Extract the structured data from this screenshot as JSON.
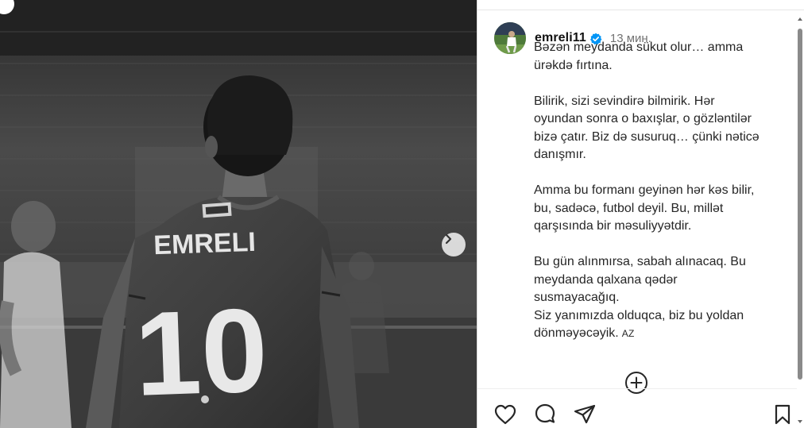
{
  "photo": {
    "jersey_name": "EMRELI",
    "jersey_number": "10",
    "alt_icon": "carousel-next-icon"
  },
  "post": {
    "username": "emreli11",
    "time": "13 мин.",
    "caption": {
      "para1": [
        "Bəzən meydanda sükut olur… amma",
        "ürəkdə fırtına."
      ],
      "para2": [
        "Bilirik, sizi sevindirə bilmirik. Hər",
        "oyundan sonra o baxışlar, o gözləntilər",
        "bizə çatır. Biz də susuruq… çünki nəticə",
        "danışmır."
      ],
      "para3": [
        "Amma bu formanı geyinən hər kəs bilir,",
        "bu, sadəcə, futbol deyil. Bu, millət",
        "qarşısında bir məsuliyyətdir."
      ],
      "para4": [
        "Bu gün alınmırsa, sabah alınacaq. Bu",
        "meydanda qalxana qədər",
        "susmayacağıq.",
        "Siz yanımızda olduqca, biz bu yoldan",
        "dönməyəcəyik."
      ],
      "lang_tag": "AZ"
    }
  },
  "icons": {
    "verified": "verified-badge-icon",
    "add": "add-circle-icon",
    "like": "heart-icon",
    "comment": "comment-icon",
    "share": "share-icon",
    "save": "bookmark-icon"
  },
  "colors": {
    "verified_blue": "#0095f6",
    "text": "#262626",
    "muted": "#737373"
  }
}
